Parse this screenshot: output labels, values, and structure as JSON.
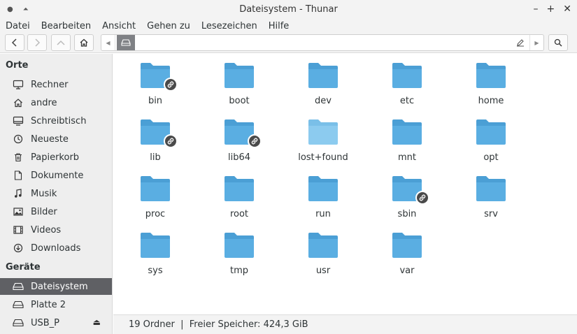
{
  "window": {
    "title": "Dateisystem - Thunar"
  },
  "menu": [
    "Datei",
    "Bearbeiten",
    "Ansicht",
    "Gehen zu",
    "Lesezeichen",
    "Hilfe"
  ],
  "sidebar": {
    "places_header": "Orte",
    "places": [
      {
        "label": "Rechner",
        "icon": "computer-icon"
      },
      {
        "label": "andre",
        "icon": "home-icon"
      },
      {
        "label": "Schreibtisch",
        "icon": "desktop-icon"
      },
      {
        "label": "Neueste",
        "icon": "clock-icon"
      },
      {
        "label": "Papierkorb",
        "icon": "trash-icon"
      },
      {
        "label": "Dokumente",
        "icon": "document-icon"
      },
      {
        "label": "Musik",
        "icon": "music-icon"
      },
      {
        "label": "Bilder",
        "icon": "image-icon"
      },
      {
        "label": "Videos",
        "icon": "video-icon"
      },
      {
        "label": "Downloads",
        "icon": "download-icon"
      }
    ],
    "devices_header": "Geräte",
    "devices": [
      {
        "label": "Dateisystem",
        "icon": "drive-icon",
        "active": true
      },
      {
        "label": "Platte 2",
        "icon": "drive-icon"
      },
      {
        "label": "USB_P",
        "icon": "drive-icon",
        "eject": true
      }
    ]
  },
  "folders": [
    {
      "name": "bin",
      "link": true
    },
    {
      "name": "boot",
      "link": false
    },
    {
      "name": "dev",
      "link": false
    },
    {
      "name": "etc",
      "link": false
    },
    {
      "name": "home",
      "link": false
    },
    {
      "name": "lib",
      "link": true
    },
    {
      "name": "lib64",
      "link": true
    },
    {
      "name": "lost+found",
      "link": false,
      "faded": true
    },
    {
      "name": "mnt",
      "link": false
    },
    {
      "name": "opt",
      "link": false
    },
    {
      "name": "proc",
      "link": false
    },
    {
      "name": "root",
      "link": false
    },
    {
      "name": "run",
      "link": false
    },
    {
      "name": "sbin",
      "link": true
    },
    {
      "name": "srv",
      "link": false
    },
    {
      "name": "sys",
      "link": false
    },
    {
      "name": "tmp",
      "link": false
    },
    {
      "name": "usr",
      "link": false
    },
    {
      "name": "var",
      "link": false
    }
  ],
  "status": {
    "text": "19 Ordner  |  Freier Speicher: 424,3 GiB"
  },
  "colors": {
    "folder": "#5aaee2",
    "folder_top": "#4b9fd5",
    "active_bg": "#5f6064"
  }
}
